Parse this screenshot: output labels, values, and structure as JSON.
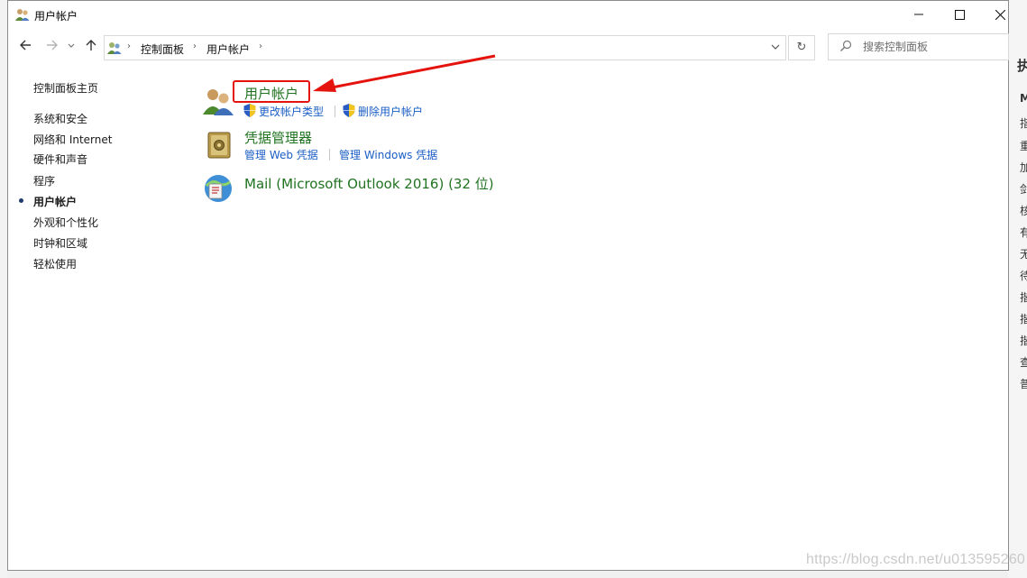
{
  "window": {
    "title": "用户帐户"
  },
  "breadcrumb": [
    "控制面板",
    "用户帐户"
  ],
  "search": {
    "placeholder": "搜索控制面板"
  },
  "sidebar": {
    "home": "控制面板主页",
    "items": [
      {
        "label": "系统和安全"
      },
      {
        "label": "网络和 Internet"
      },
      {
        "label": "硬件和声音"
      },
      {
        "label": "程序"
      },
      {
        "label": "用户帐户",
        "active": true
      },
      {
        "label": "外观和个性化"
      },
      {
        "label": "时钟和区域"
      },
      {
        "label": "轻松使用"
      }
    ]
  },
  "categories": {
    "user_accounts": {
      "title": "用户帐户",
      "links": [
        "更改帐户类型",
        "删除用户帐户"
      ]
    },
    "credential_manager": {
      "title": "凭据管理器",
      "links": [
        "管理 Web 凭据",
        "管理 Windows 凭据"
      ]
    },
    "mail": {
      "title": "Mail (Microsoft Outlook 2016) (32 位)"
    }
  },
  "background_glyphs": [
    "执",
    "M",
    "指",
    "重",
    "加",
    "剑",
    "核",
    "有",
    "无",
    "待",
    "揩",
    "揩",
    "揩",
    "查",
    "普"
  ],
  "watermark": "https://blog.csdn.net/u013595260",
  "colors": {
    "title_link_green": "#207320",
    "task_link_blue": "#1b5ec5",
    "highlight_red": "#e4130d",
    "window_bg": "#ffffff"
  },
  "icons": {
    "title": "users-icon",
    "back": "arrow-left-icon",
    "forward": "arrow-right-icon",
    "recent": "chevron-down-icon",
    "up": "arrow-up-icon",
    "refresh": "refresh-icon",
    "search": "search-icon"
  }
}
